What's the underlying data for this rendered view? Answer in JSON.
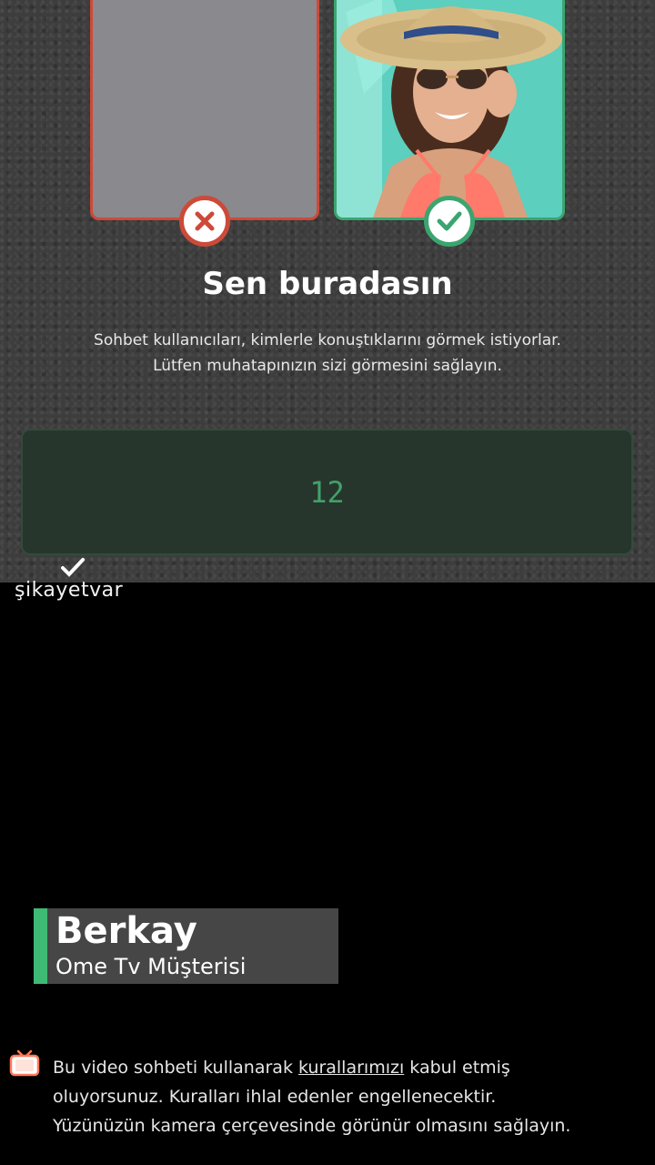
{
  "screen": {
    "title": "Sen buradasın",
    "description_lines": [
      "Sohbet kullanıcıları, kimlerle konuştıklarını görmek istiyorlar.",
      "Lütfen muhatapınızın sizi görmesini sağlayın."
    ],
    "counter": "12",
    "bad_example_icon": "close-icon",
    "good_example_icon": "check-icon"
  },
  "watermark": {
    "brand": "şikayetvar"
  },
  "lower_third": {
    "name": "Berkay",
    "role": "Ome Tv Müşterisi"
  },
  "notice": {
    "icon": "ome-tv-icon",
    "line1_before": "Bu video sohbeti kullanarak ",
    "line1_link": "kurallarımızı",
    "line1_after": " kabul etmiş",
    "line2": "oluyorsunuz. Kuralları ihlal edenler engellenecektir.",
    "line3": "Yüzünüzün kamera çerçevesinde görünür olmasını sağlayın."
  },
  "colors": {
    "reject": "#cc4a39",
    "accept": "#3ba56f",
    "lower_third_accent": "#3fba74"
  }
}
